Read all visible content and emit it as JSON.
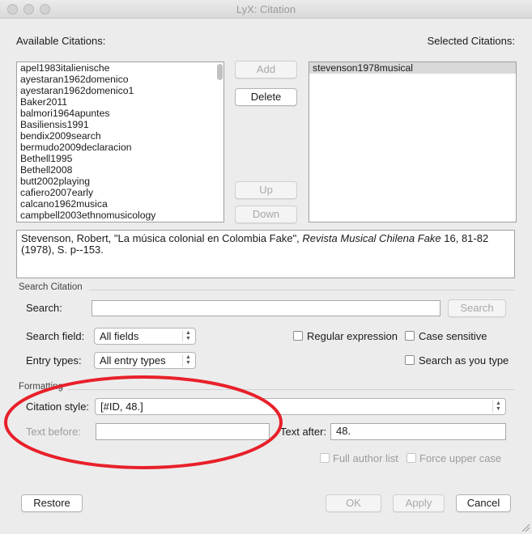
{
  "window": {
    "title": "LyX: Citation"
  },
  "available": {
    "label": "Available Citations:",
    "items": [
      "apel1983italienische",
      "ayestaran1962domenico",
      "ayestaran1962domenico1",
      "Baker2011",
      "balmori1964apuntes",
      "Basiliensis1991",
      "bendix2009search",
      "bermudo2009declaracion",
      "Bethell1995",
      "Bethell2008",
      "butt2002playing",
      "cafiero2007early",
      "calcano1962musica",
      "campbell2003ethnomusicology"
    ]
  },
  "selected": {
    "label": "Selected Citations:",
    "items": [
      "stevenson1978musical"
    ]
  },
  "buttons": {
    "add": "Add",
    "delete": "Delete",
    "up": "Up",
    "down": "Down",
    "search": "Search",
    "restore": "Restore",
    "ok": "OK",
    "apply": "Apply",
    "cancel": "Cancel"
  },
  "preview": {
    "part1": "Stevenson, Robert, \"La música colonial en Colombia Fake\", ",
    "italic": "Revista Musical Chilena Fake",
    "part2": " 16, 81-82 (1978), S. p--153."
  },
  "search": {
    "section_label": "Search Citation",
    "search_label": "Search:",
    "search_value": "",
    "field_label": "Search field:",
    "field_value": "All fields",
    "entry_label": "Entry types:",
    "entry_value": "All entry types",
    "regex_label": "Regular expression",
    "case_label": "Case sensitive",
    "asyoutype_label": "Search as you type"
  },
  "formatting": {
    "section_label": "Formatting",
    "style_label": "Citation style:",
    "style_value": "[#ID, 48.]",
    "before_label": "Text before:",
    "before_value": "",
    "after_label": "Text after:",
    "after_value": "48.",
    "full_author_label": "Full author list",
    "force_upper_label": "Force upper case"
  },
  "annotation": {
    "color": "#e8202a"
  }
}
